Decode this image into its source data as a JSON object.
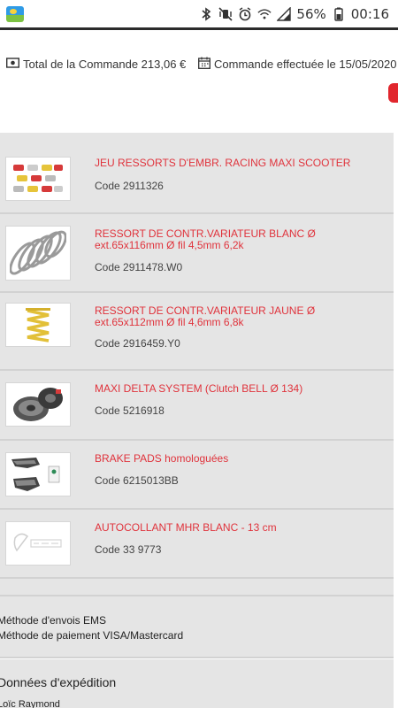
{
  "status_bar": {
    "battery_percent": "56%",
    "time": "00:16",
    "icons": [
      "bluetooth-icon",
      "vibrate-mute-icon",
      "alarm-icon",
      "wifi-icon",
      "signal-icon",
      "battery-icon"
    ]
  },
  "summary": {
    "total_text": "Total de la Commande 213,06 €",
    "date_text": "Commande effectuée le 15/05/2020"
  },
  "products": [
    {
      "name": "JEU RESSORTS D'EMBR. RACING MAXI SCOOTER",
      "code": "Code 2911326",
      "image": "clutch-springs-image"
    },
    {
      "name": "RESSORT DE CONTR.VARIATEUR BLANC Ø ext.65x116mm Ø fil 4,5mm 6,2k",
      "code": "Code 2911478.W0",
      "image": "white-spring-image"
    },
    {
      "name": "RESSORT DE CONTR.VARIATEUR JAUNE Ø ext.65x112mm Ø fil 4,6mm 6,8k",
      "code": "Code 2916459.Y0",
      "image": "yellow-spring-image"
    },
    {
      "name": "MAXI DELTA SYSTEM (Clutch BELL Ø 134)",
      "code": "Code 5216918",
      "image": "clutch-bell-image"
    },
    {
      "name": "BRAKE PADS homologuées",
      "code": "Code 6215013BB",
      "image": "brake-pads-image"
    },
    {
      "name": "AUTOCOLLANT MHR BLANC - 13 cm",
      "code": "Code 33 9773",
      "image": "sticker-image"
    }
  ],
  "methods": {
    "shipping": "Méthode d'envois EMS",
    "payment": "Méthode de paiement VISA/Mastercard"
  },
  "shipping_data": {
    "title": "Données d'expédition",
    "name": "Loïc Raymond"
  },
  "colors": {
    "accent": "#e0333c",
    "panel": "#e5e5e5"
  }
}
